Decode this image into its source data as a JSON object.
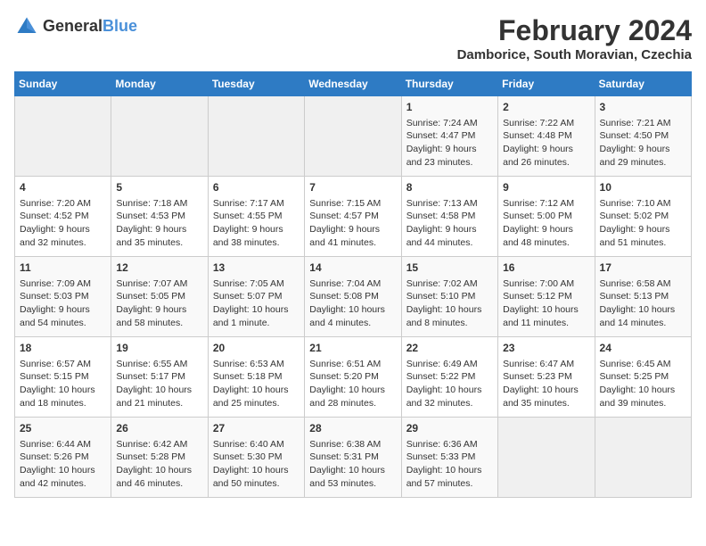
{
  "logo": {
    "text_general": "General",
    "text_blue": "Blue"
  },
  "title": "February 2024",
  "subtitle": "Damborice, South Moravian, Czechia",
  "headers": [
    "Sunday",
    "Monday",
    "Tuesday",
    "Wednesday",
    "Thursday",
    "Friday",
    "Saturday"
  ],
  "weeks": [
    [
      {
        "day": "",
        "content": ""
      },
      {
        "day": "",
        "content": ""
      },
      {
        "day": "",
        "content": ""
      },
      {
        "day": "",
        "content": ""
      },
      {
        "day": "1",
        "content": "Sunrise: 7:24 AM\nSunset: 4:47 PM\nDaylight: 9 hours\nand 23 minutes."
      },
      {
        "day": "2",
        "content": "Sunrise: 7:22 AM\nSunset: 4:48 PM\nDaylight: 9 hours\nand 26 minutes."
      },
      {
        "day": "3",
        "content": "Sunrise: 7:21 AM\nSunset: 4:50 PM\nDaylight: 9 hours\nand 29 minutes."
      }
    ],
    [
      {
        "day": "4",
        "content": "Sunrise: 7:20 AM\nSunset: 4:52 PM\nDaylight: 9 hours\nand 32 minutes."
      },
      {
        "day": "5",
        "content": "Sunrise: 7:18 AM\nSunset: 4:53 PM\nDaylight: 9 hours\nand 35 minutes."
      },
      {
        "day": "6",
        "content": "Sunrise: 7:17 AM\nSunset: 4:55 PM\nDaylight: 9 hours\nand 38 minutes."
      },
      {
        "day": "7",
        "content": "Sunrise: 7:15 AM\nSunset: 4:57 PM\nDaylight: 9 hours\nand 41 minutes."
      },
      {
        "day": "8",
        "content": "Sunrise: 7:13 AM\nSunset: 4:58 PM\nDaylight: 9 hours\nand 44 minutes."
      },
      {
        "day": "9",
        "content": "Sunrise: 7:12 AM\nSunset: 5:00 PM\nDaylight: 9 hours\nand 48 minutes."
      },
      {
        "day": "10",
        "content": "Sunrise: 7:10 AM\nSunset: 5:02 PM\nDaylight: 9 hours\nand 51 minutes."
      }
    ],
    [
      {
        "day": "11",
        "content": "Sunrise: 7:09 AM\nSunset: 5:03 PM\nDaylight: 9 hours\nand 54 minutes."
      },
      {
        "day": "12",
        "content": "Sunrise: 7:07 AM\nSunset: 5:05 PM\nDaylight: 9 hours\nand 58 minutes."
      },
      {
        "day": "13",
        "content": "Sunrise: 7:05 AM\nSunset: 5:07 PM\nDaylight: 10 hours\nand 1 minute."
      },
      {
        "day": "14",
        "content": "Sunrise: 7:04 AM\nSunset: 5:08 PM\nDaylight: 10 hours\nand 4 minutes."
      },
      {
        "day": "15",
        "content": "Sunrise: 7:02 AM\nSunset: 5:10 PM\nDaylight: 10 hours\nand 8 minutes."
      },
      {
        "day": "16",
        "content": "Sunrise: 7:00 AM\nSunset: 5:12 PM\nDaylight: 10 hours\nand 11 minutes."
      },
      {
        "day": "17",
        "content": "Sunrise: 6:58 AM\nSunset: 5:13 PM\nDaylight: 10 hours\nand 14 minutes."
      }
    ],
    [
      {
        "day": "18",
        "content": "Sunrise: 6:57 AM\nSunset: 5:15 PM\nDaylight: 10 hours\nand 18 minutes."
      },
      {
        "day": "19",
        "content": "Sunrise: 6:55 AM\nSunset: 5:17 PM\nDaylight: 10 hours\nand 21 minutes."
      },
      {
        "day": "20",
        "content": "Sunrise: 6:53 AM\nSunset: 5:18 PM\nDaylight: 10 hours\nand 25 minutes."
      },
      {
        "day": "21",
        "content": "Sunrise: 6:51 AM\nSunset: 5:20 PM\nDaylight: 10 hours\nand 28 minutes."
      },
      {
        "day": "22",
        "content": "Sunrise: 6:49 AM\nSunset: 5:22 PM\nDaylight: 10 hours\nand 32 minutes."
      },
      {
        "day": "23",
        "content": "Sunrise: 6:47 AM\nSunset: 5:23 PM\nDaylight: 10 hours\nand 35 minutes."
      },
      {
        "day": "24",
        "content": "Sunrise: 6:45 AM\nSunset: 5:25 PM\nDaylight: 10 hours\nand 39 minutes."
      }
    ],
    [
      {
        "day": "25",
        "content": "Sunrise: 6:44 AM\nSunset: 5:26 PM\nDaylight: 10 hours\nand 42 minutes."
      },
      {
        "day": "26",
        "content": "Sunrise: 6:42 AM\nSunset: 5:28 PM\nDaylight: 10 hours\nand 46 minutes."
      },
      {
        "day": "27",
        "content": "Sunrise: 6:40 AM\nSunset: 5:30 PM\nDaylight: 10 hours\nand 50 minutes."
      },
      {
        "day": "28",
        "content": "Sunrise: 6:38 AM\nSunset: 5:31 PM\nDaylight: 10 hours\nand 53 minutes."
      },
      {
        "day": "29",
        "content": "Sunrise: 6:36 AM\nSunset: 5:33 PM\nDaylight: 10 hours\nand 57 minutes."
      },
      {
        "day": "",
        "content": ""
      },
      {
        "day": "",
        "content": ""
      }
    ]
  ]
}
